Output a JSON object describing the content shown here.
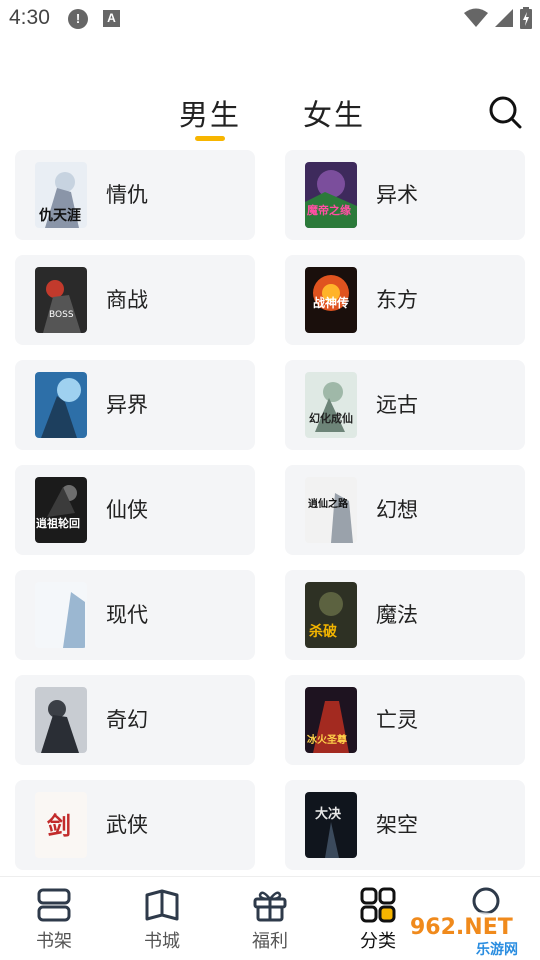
{
  "status_bar": {
    "time": "4:30",
    "alert_glyph": "!",
    "a_glyph": "A"
  },
  "tabs": [
    {
      "label": "男生",
      "active": true
    },
    {
      "label": "女生",
      "active": false
    }
  ],
  "accent_color": "#f7b500",
  "search_icon": "search-icon",
  "categories": [
    {
      "label": "情仇",
      "cover_text": "仇天涯"
    },
    {
      "label": "异术",
      "cover_text": "魔帝之缘"
    },
    {
      "label": "商战",
      "cover_text": "BOSS"
    },
    {
      "label": "东方",
      "cover_text": "战神传"
    },
    {
      "label": "异界",
      "cover_text": ""
    },
    {
      "label": "远古",
      "cover_text": "幻化成仙"
    },
    {
      "label": "仙侠",
      "cover_text": "逍祖轮回"
    },
    {
      "label": "幻想",
      "cover_text": "逍仙之路"
    },
    {
      "label": "现代",
      "cover_text": ""
    },
    {
      "label": "魔法",
      "cover_text": "杀破"
    },
    {
      "label": "奇幻",
      "cover_text": ""
    },
    {
      "label": "亡灵",
      "cover_text": "冰火圣尊"
    },
    {
      "label": "武侠",
      "cover_text": "剑"
    },
    {
      "label": "架空",
      "cover_text": "大决"
    }
  ],
  "bottom_nav": [
    {
      "label": "书架",
      "icon": "bookshelf-icon",
      "active": false
    },
    {
      "label": "书城",
      "icon": "book-icon",
      "active": false
    },
    {
      "label": "福利",
      "icon": "gift-icon",
      "active": false
    },
    {
      "label": "分类",
      "icon": "category-grid-icon",
      "active": true
    },
    {
      "label": "",
      "icon": "profile-icon",
      "active": false
    }
  ],
  "watermark": {
    "brand": "962.NET",
    "sub": "乐游网"
  }
}
